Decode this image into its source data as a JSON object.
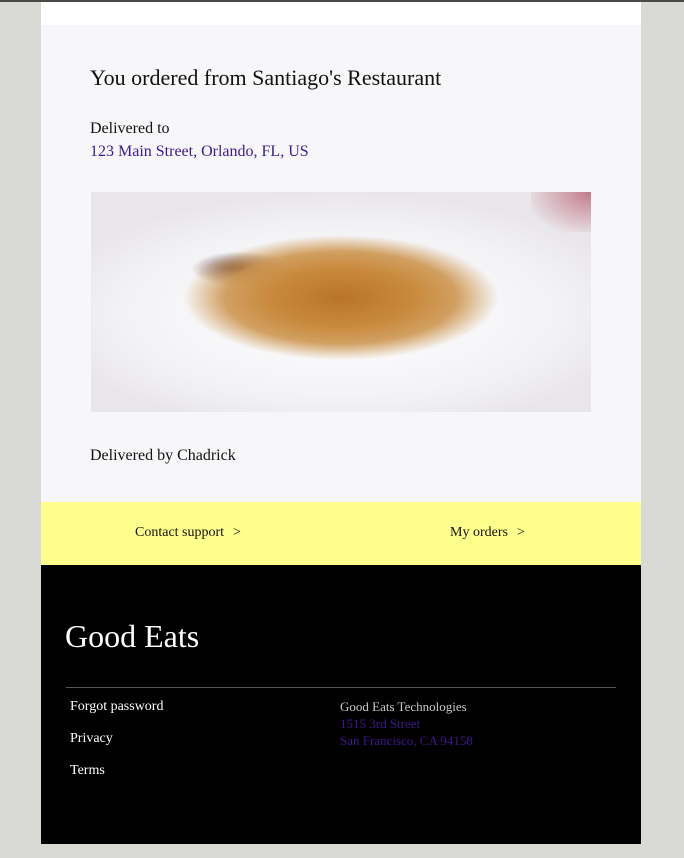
{
  "order": {
    "title": "You ordered from Santiago's Restaurant",
    "delivered_label": "Delivered to",
    "address": "123 Main Street, Orlando, FL, US",
    "driver": "Delivered by Chadrick"
  },
  "actions": {
    "contact_support": "Contact support",
    "my_orders": "My orders",
    "chevron": ">"
  },
  "footer": {
    "brand": "Good Eats",
    "links": [
      "Forgot password",
      "Privacy",
      "Terms"
    ],
    "company": "Good Eats Technologies",
    "address_line1": "1515 3rd Street",
    "address_line2": "San Francisco, CA 94158"
  }
}
